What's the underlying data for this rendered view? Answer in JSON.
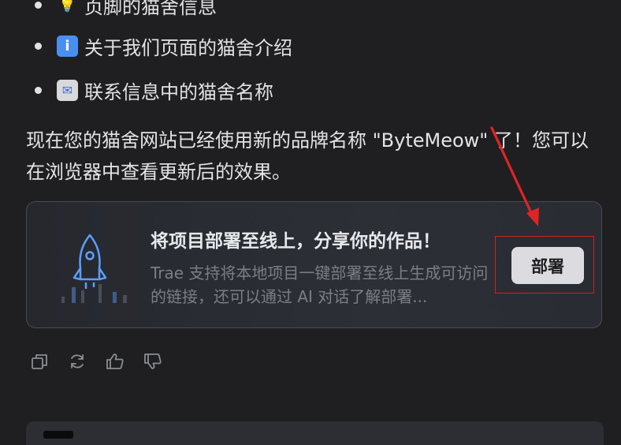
{
  "bullets": [
    {
      "icon": "lightbulb-icon",
      "glyph": "💡",
      "text": "页脚的猫舍信息"
    },
    {
      "icon": "info-icon",
      "glyph": "i",
      "text": "关于我们页面的猫舍介绍"
    },
    {
      "icon": "mail-icon",
      "glyph": "✉",
      "text": "联系信息中的猫舍名称"
    }
  ],
  "summary": "现在您的猫舍网站已经使用新的品牌名称 \"ByteMeow\" 了！您可以在浏览器中查看更新后的效果。",
  "deploy_card": {
    "title": "将项目部署至线上，分享你的作品！",
    "description": "Trae 支持将本地项目一键部署至线上生成可访问的链接，还可以通过 AI 对话了解部署...",
    "button_label": "部署"
  },
  "actions": [
    {
      "name": "copy-icon"
    },
    {
      "name": "regenerate-icon"
    },
    {
      "name": "thumbs-up-icon"
    },
    {
      "name": "thumbs-down-icon"
    }
  ],
  "colors": {
    "background": "#1f1f22",
    "accent_blue": "#4a8ff0",
    "annotation_red": "#d42020"
  }
}
